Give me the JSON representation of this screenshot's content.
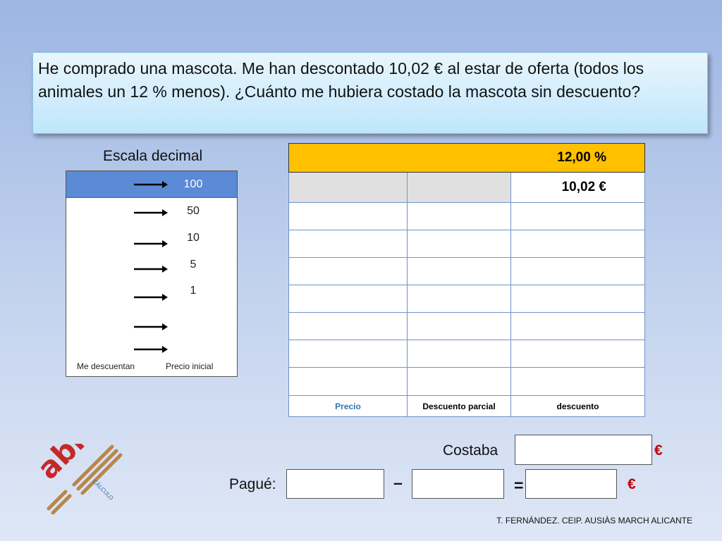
{
  "problem": {
    "text": "He comprado una mascota. Me han descontado 10,02 € al estar de oferta (todos los animales un 12 % menos). ¿Cuánto me hubiera costado la mascota sin descuento?"
  },
  "scale": {
    "title": "Escala decimal",
    "values": [
      "100",
      "50",
      "10",
      "5",
      "1"
    ],
    "footer_left": "Me descuentan",
    "footer_right": "Precio inicial"
  },
  "grid": {
    "header_value": "12,00 %",
    "first_row_value": "10,02 €",
    "footer": [
      "Precio",
      "Descuento parcial",
      "descuento"
    ]
  },
  "answer": {
    "costaba_label": "Costaba",
    "pague_label": "Pagué:",
    "minus": "–",
    "equals": "=",
    "euro": "€"
  },
  "logo": {
    "text": "abn",
    "sub": "CÁLCULO"
  },
  "credit": "T. FERNÁNDEZ. CEIP. AUSIÀS MARCH  ALICANTE",
  "colors": {
    "header_orange": "#ffc000",
    "scale_blue": "#5b8ad6",
    "euro_red": "#c00000"
  }
}
